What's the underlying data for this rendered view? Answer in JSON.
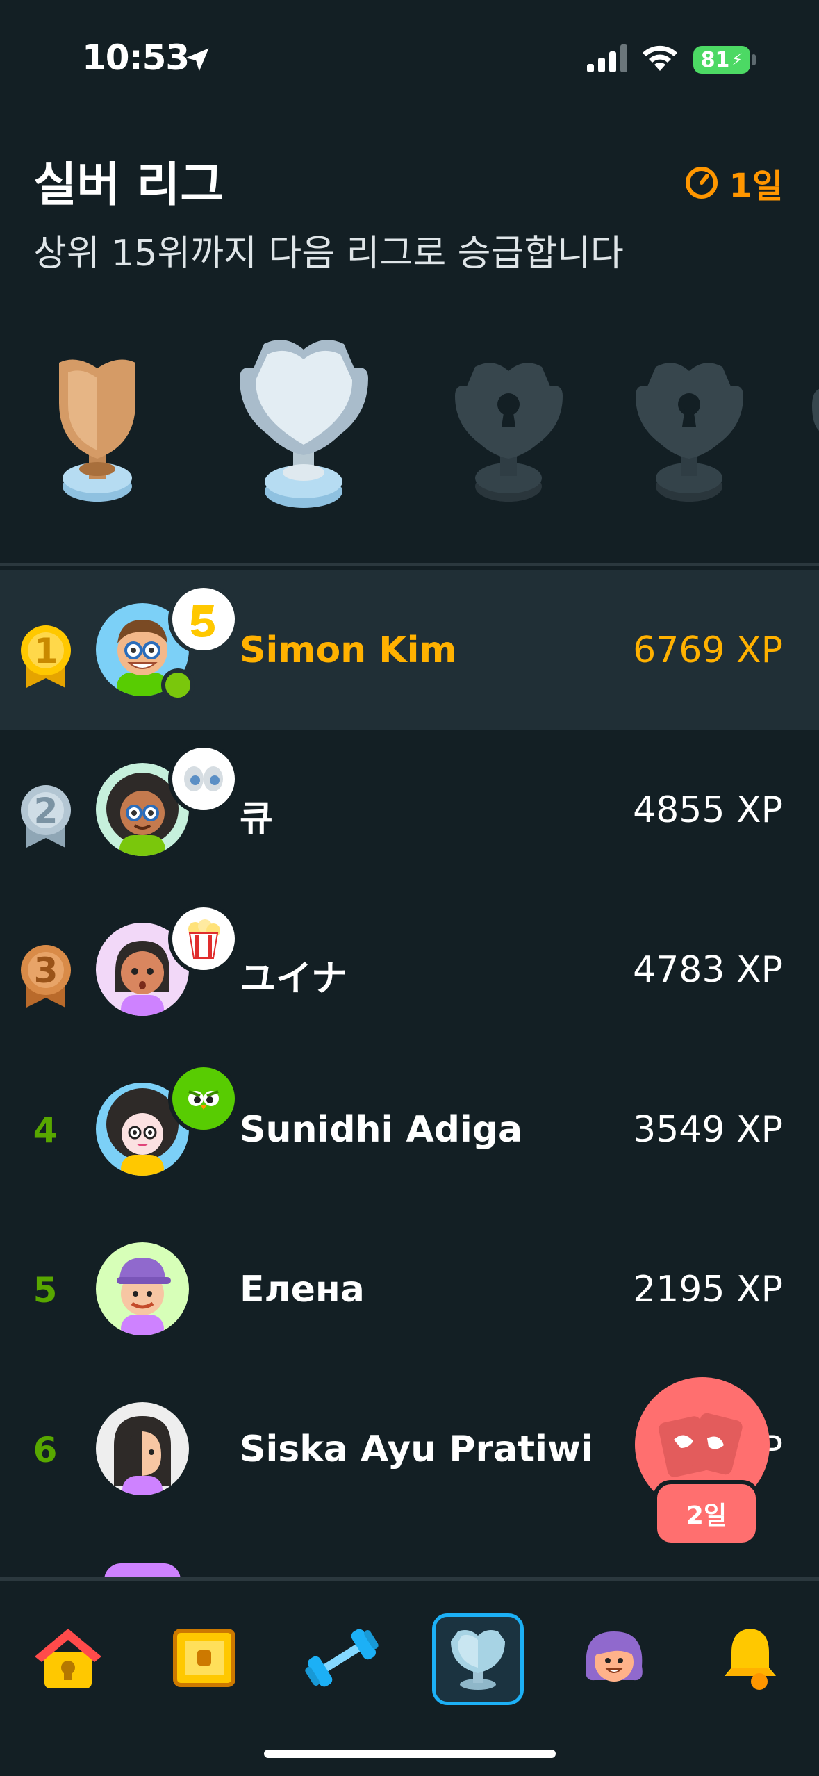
{
  "status_bar": {
    "time": "10:53",
    "battery": "81"
  },
  "header": {
    "title": "실버 리그",
    "subtitle": "상위 15위까지 다음 리그로 승급합니다",
    "timer": "1일"
  },
  "leaderboard": [
    {
      "rank": "1",
      "name": "Simon Kim",
      "xp": "6769 XP"
    },
    {
      "rank": "2",
      "name": "큐",
      "xp": "4855 XP"
    },
    {
      "rank": "3",
      "name": "ユイナ",
      "xp": "4783 XP"
    },
    {
      "rank": "4",
      "name": "Sunidhi Adiga",
      "xp": "3549 XP"
    },
    {
      "rank": "5",
      "name": "Елена",
      "xp": "2195 XP"
    },
    {
      "rank": "6",
      "name": "Siska Ayu Pratiwi",
      "xp": "P"
    }
  ],
  "float_chest": {
    "label": "2일"
  },
  "nav": [
    "home-icon",
    "chest-icon",
    "dumbbell-icon",
    "league-trophy-icon",
    "profile-icon",
    "bell-icon"
  ],
  "colors": {
    "background": "#131f24",
    "highlight": "#202f36",
    "accent_orange": "#ff9600",
    "rank_green": "#58a700",
    "chest_red": "#ff6f6f",
    "nav_active": "#1cb0f6"
  }
}
